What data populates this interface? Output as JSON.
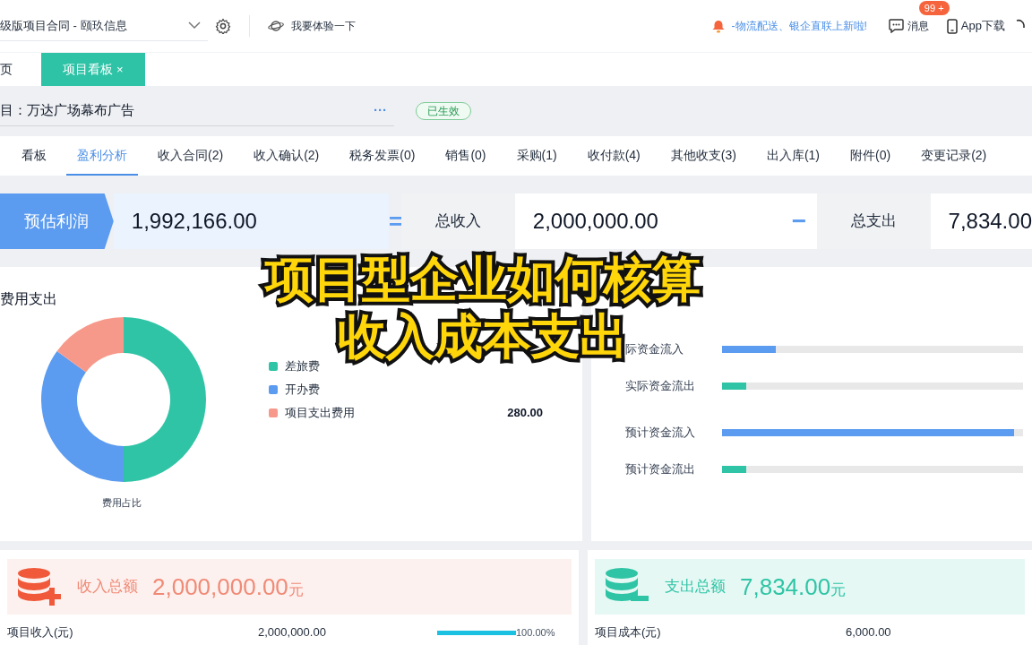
{
  "header": {
    "title": "级版项目合同 - 颐玖信息",
    "try_label": "我要体验一下",
    "announcement": "-物流配送、银企直联上新啦!",
    "messages": {
      "label": "消息",
      "badge": "99 +"
    },
    "app_download": "App下载"
  },
  "tabs": [
    {
      "label": "页",
      "selected": false,
      "closable": false
    },
    {
      "label": "项目看板",
      "selected": true,
      "closable": true,
      "close": "×"
    }
  ],
  "project": {
    "label": "目：",
    "name": "万达广场幕布广告",
    "more": "···",
    "status": "已生效"
  },
  "subtabs": [
    {
      "label": "看板",
      "selected": false
    },
    {
      "label": "盈利分析",
      "selected": true
    },
    {
      "label": "收入合同(2)",
      "selected": false
    },
    {
      "label": "收入确认(2)",
      "selected": false
    },
    {
      "label": "税务发票(0)",
      "selected": false
    },
    {
      "label": "销售(0)",
      "selected": false
    },
    {
      "label": "采购(1)",
      "selected": false
    },
    {
      "label": "收付款(4)",
      "selected": false
    },
    {
      "label": "其他收支(3)",
      "selected": false
    },
    {
      "label": "出入库(1)",
      "selected": false
    },
    {
      "label": "附件(0)",
      "selected": false
    },
    {
      "label": "变更记录(2)",
      "selected": false
    }
  ],
  "summary": {
    "profit_label": "预估利润",
    "profit": "1,992,166.00",
    "equals": "=",
    "income_label": "总收入",
    "income": "2,000,000.00",
    "minus": "−",
    "expense_label": "总支出",
    "expense": "7,834.00"
  },
  "expense_panel": {
    "title": "费用支出",
    "chart_caption": "费用占比",
    "legend": [
      {
        "name": "差旅费",
        "color": "#2fc4a5"
      },
      {
        "name": "开办费",
        "color": "#5b9bf0"
      },
      {
        "name": "项目支出费用",
        "color": "#f7998a",
        "value": "280.00"
      }
    ]
  },
  "cash_flow": [
    {
      "label": "际资金流入",
      "level": 0.18,
      "color": "#5b9bf0"
    },
    {
      "label": "实际资金流出",
      "level": 0.08,
      "color": "#2fc4a5"
    },
    {
      "label": "预计资金流入",
      "level": 0.97,
      "color": "#5b9bf0"
    },
    {
      "label": "预计资金流出",
      "level": 0.08,
      "color": "#2fc4a5"
    }
  ],
  "income_card": {
    "label": "收入总额",
    "amount": "2,000,000.00",
    "unit": "元",
    "rows": [
      {
        "name": "项目收入(元)",
        "amount": "2,000,000.00",
        "level": 1.0,
        "percent": "100.00%"
      }
    ]
  },
  "expense_card": {
    "label": "支出总额",
    "amount": "7,834.00",
    "unit": "元",
    "rows": [
      {
        "name": "项目成本(元)",
        "amount": "6,000.00"
      }
    ]
  },
  "caption": [
    "项目型企业如何核算",
    "收入成本支出"
  ]
}
